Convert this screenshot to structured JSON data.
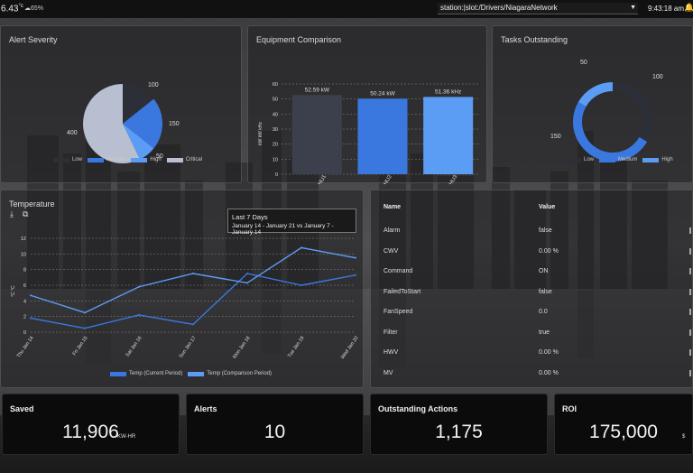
{
  "topbar": {
    "temperature": "6.43",
    "temp_unit": "°c",
    "humidity": "65%",
    "ord_path": "station:|slot:/Drivers/NiagaraNetwork",
    "time": "9:43:18 am"
  },
  "alert_severity": {
    "title": "Alert Severity",
    "slices": [
      {
        "label": "100",
        "value": 100,
        "color": "#2d2f38"
      },
      {
        "label": "150",
        "value": 150,
        "color": "#3a78e0"
      },
      {
        "label": "50",
        "value": 50,
        "color": "#5b9cf5"
      },
      {
        "label": "400",
        "value": 400,
        "color": "#b8bfd0"
      }
    ],
    "legend": [
      {
        "label": "Low",
        "color": "#2d2f38"
      },
      {
        "label": "Medium",
        "color": "#3a78e0"
      },
      {
        "label": "High",
        "color": "#5b9cf5"
      },
      {
        "label": "Critical",
        "color": "#b8bfd0"
      }
    ]
  },
  "equipment": {
    "title": "Equipment Comparison",
    "ylabel": "kW kW kHz",
    "bars": [
      {
        "category": "AHU1",
        "value": 52.59,
        "label": "52.59 kW",
        "color": "#3b404c"
      },
      {
        "category": "AHU2",
        "value": 50.24,
        "label": "50.24 kW",
        "color": "#3a78e0"
      },
      {
        "category": "AHU3",
        "value": 51.36,
        "label": "51.36 kHz",
        "color": "#5b9cf5"
      }
    ],
    "yticks": [
      "0",
      "10",
      "20",
      "30",
      "40",
      "50",
      "60"
    ],
    "ylim": [
      0,
      60
    ]
  },
  "tasks": {
    "title": "Tasks Outstanding",
    "slices": [
      {
        "label": "100",
        "value": 100,
        "color": "#2d2f38"
      },
      {
        "label": "150",
        "value": 150,
        "color": "#3a78e0"
      },
      {
        "label": "50",
        "value": 50,
        "color": "#5b9cf5"
      }
    ],
    "legend": [
      {
        "label": "Low",
        "color": "#2d2f38"
      },
      {
        "label": "Medium",
        "color": "#3a78e0"
      },
      {
        "label": "High",
        "color": "#5b9cf5"
      }
    ]
  },
  "temperature": {
    "title": "Temperature",
    "ylabel": "°C °C",
    "tooltip_title": "Last 7 Days",
    "tooltip_range": "January 14 - January 21 vs January 7 - January 14",
    "legend": [
      {
        "label": "Temp (Current Period)",
        "color": "#3a78e0"
      },
      {
        "label": "Temp (Comparison Period)",
        "color": "#5b9cf5"
      }
    ]
  },
  "chart_data": {
    "type": "line",
    "categories": [
      "Thu Jan 14",
      "Fri Jan 15",
      "Sat Jan 16",
      "Sun Jan 17",
      "Mon Jan 18",
      "Tue Jan 19",
      "Wed Jan 20"
    ],
    "yticks": [
      "0",
      "2",
      "4",
      "6",
      "8",
      "10",
      "12"
    ],
    "ylim": [
      0,
      12
    ],
    "series": [
      {
        "name": "Temp (Current Period)",
        "color": "#3a78e0",
        "values": [
          1.8,
          0.5,
          2.2,
          1.0,
          7.5,
          6.0,
          7.3
        ]
      },
      {
        "name": "Temp (Comparison Period)",
        "color": "#5b9cf5",
        "values": [
          4.7,
          2.5,
          5.8,
          7.5,
          6.3,
          10.8,
          9.5
        ]
      }
    ]
  },
  "table": {
    "col_name": "Name",
    "col_value": "Value",
    "rows": [
      {
        "name": "Alarm",
        "value": "false"
      },
      {
        "name": "CWV",
        "value": "0.00 %"
      },
      {
        "name": "Command",
        "value": "ON"
      },
      {
        "name": "FailedToStart",
        "value": "false"
      },
      {
        "name": "FanSpeed",
        "value": "0.0"
      },
      {
        "name": "Filter",
        "value": "true"
      },
      {
        "name": "HWV",
        "value": "0.00 %"
      },
      {
        "name": "MV",
        "value": "0.00 %"
      }
    ]
  },
  "kpis": [
    {
      "label": "Saved",
      "value": "11,906",
      "unit": "KW-HR"
    },
    {
      "label": "Alerts",
      "value": "10",
      "unit": ""
    },
    {
      "label": "Outstanding Actions",
      "value": "1,175",
      "unit": ""
    },
    {
      "label": "ROI",
      "value": "175,000",
      "unit": "$"
    }
  ]
}
